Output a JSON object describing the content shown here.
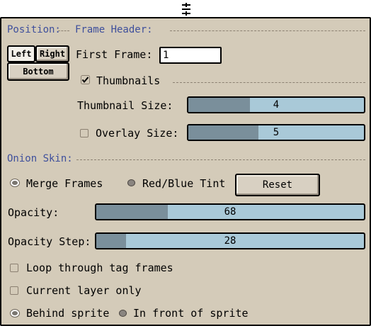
{
  "position": {
    "section_label": "Position:",
    "left_label": "Left",
    "right_label": "Right",
    "bottom_label": "Bottom"
  },
  "frame_header": {
    "section_label": "Frame Header:",
    "first_frame_label": "First Frame:",
    "first_frame_value": "1",
    "thumbnails_label": "Thumbnails",
    "thumbnails_checked": true,
    "thumbnail_size_label": "Thumbnail Size:",
    "thumbnail_size_value": "4",
    "thumbnail_size_level": 0.35,
    "overlay_size_label": "Overlay Size:",
    "overlay_size_checked": false,
    "overlay_size_value": "5",
    "overlay_size_level": 0.4
  },
  "onion_skin": {
    "section_label": "Onion Skin:",
    "merge_frames_label": "Merge Frames",
    "merge_frames_selected": true,
    "red_blue_tint_label": "Red/Blue Tint",
    "reset_label": "Reset",
    "opacity_label": "Opacity:",
    "opacity_value": "68",
    "opacity_level": 0.267,
    "opacity_step_label": "Opacity Step:",
    "opacity_step_value": "28",
    "opacity_step_level": 0.11,
    "loop_label": "Loop through tag frames",
    "loop_checked": false,
    "current_layer_label": "Current layer only",
    "current_layer_checked": false,
    "behind_sprite_label": "Behind sprite",
    "behind_sprite_selected": true,
    "in_front_label": "In front of sprite"
  }
}
